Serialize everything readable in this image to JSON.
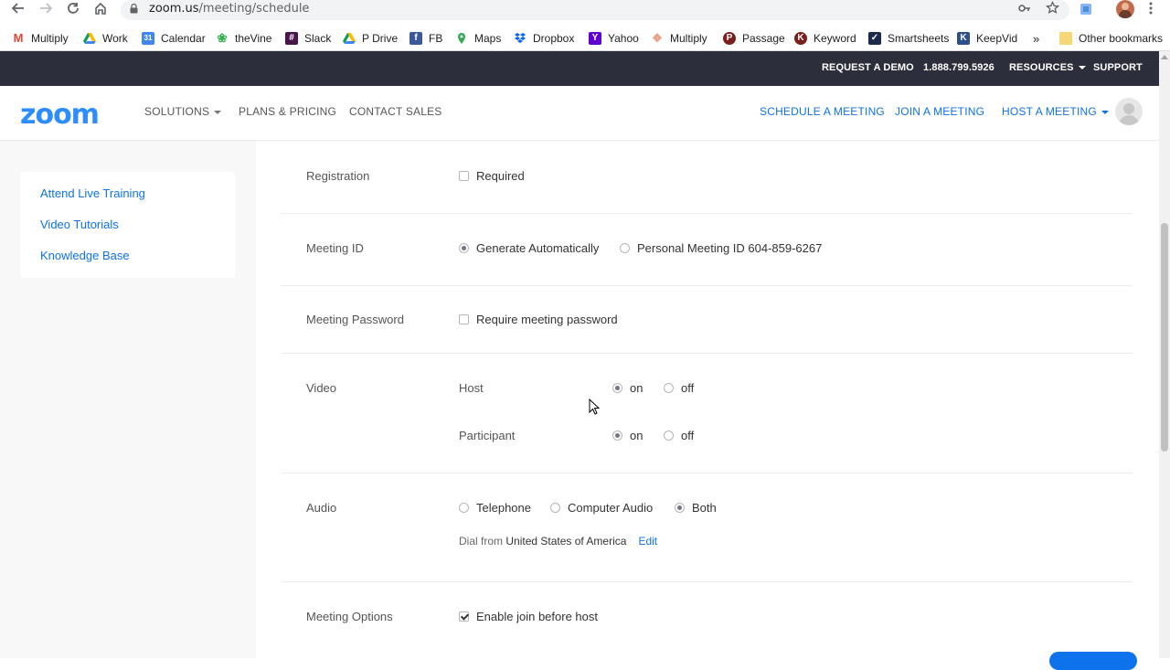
{
  "browser": {
    "url_host": "zoom.us",
    "url_path": "/meeting/schedule",
    "more_bookmarks": "»",
    "bookmarks": [
      {
        "label": "Multiply",
        "icon": "gmail-icon",
        "color": "#ea4335"
      },
      {
        "label": "Work",
        "icon": "drive-icon",
        "color": "#0f9d58"
      },
      {
        "label": "Calendar",
        "icon": "calendar-icon",
        "color": "#4285f4"
      },
      {
        "label": "theVine",
        "icon": "vine-icon",
        "color": "#2db34a"
      },
      {
        "label": "Slack",
        "icon": "slack-icon",
        "color": "#4a154b"
      },
      {
        "label": "P Drive",
        "icon": "drive-icon",
        "color": "#0f9d58"
      },
      {
        "label": "FB",
        "icon": "facebook-icon",
        "color": "#3b5998"
      },
      {
        "label": "Maps",
        "icon": "maps-icon",
        "color": "#34a853"
      },
      {
        "label": "Dropbox",
        "icon": "dropbox-icon",
        "color": "#0061ff"
      },
      {
        "label": "Yahoo",
        "icon": "yahoo-icon",
        "color": "#5f01d1"
      },
      {
        "label": "Multiply",
        "icon": "multiply-icon",
        "color": "#e8a08a"
      },
      {
        "label": "Passage",
        "icon": "passage-icon",
        "color": "#7a1e1e"
      },
      {
        "label": "Keyword",
        "icon": "keyword-icon",
        "color": "#7a1e1e"
      },
      {
        "label": "Smartsheets",
        "icon": "smartsheets-icon",
        "color": "#1b2a4a"
      },
      {
        "label": "KeepVid",
        "icon": "keepvid-icon",
        "color": "#2d4f8b"
      }
    ],
    "other_bookmarks": "Other bookmarks"
  },
  "topbar": {
    "request_demo": "REQUEST A DEMO",
    "phone": "1.888.799.5926",
    "resources": "RESOURCES",
    "support": "SUPPORT"
  },
  "nav": {
    "logo": "zoom",
    "solutions": "SOLUTIONS",
    "plans": "PLANS & PRICING",
    "contact": "CONTACT SALES",
    "schedule": "SCHEDULE A MEETING",
    "join": "JOIN A MEETING",
    "host": "HOST A MEETING"
  },
  "sidebar": {
    "items": [
      "Attend Live Training",
      "Video Tutorials",
      "Knowledge Base"
    ]
  },
  "form": {
    "registration": {
      "label": "Registration",
      "option": "Required",
      "checked": false
    },
    "meeting_id": {
      "label": "Meeting ID",
      "opt1": "Generate Automatically",
      "opt2": "Personal Meeting ID 604-859-6267",
      "selected": "Generate Automatically"
    },
    "password": {
      "label": "Meeting Password",
      "option": "Require meeting password",
      "checked": false
    },
    "video": {
      "label": "Video",
      "host_label": "Host",
      "participant_label": "Participant",
      "on": "on",
      "off": "off",
      "host": "on",
      "participant": "on"
    },
    "audio": {
      "label": "Audio",
      "opt1": "Telephone",
      "opt2": "Computer Audio",
      "opt3": "Both",
      "selected": "Both",
      "dial_prefix": "Dial from",
      "dial_country": "United States of America",
      "edit": "Edit"
    },
    "options": {
      "label": "Meeting Options",
      "opt1": "Enable join before host",
      "opt1_checked": true
    }
  }
}
